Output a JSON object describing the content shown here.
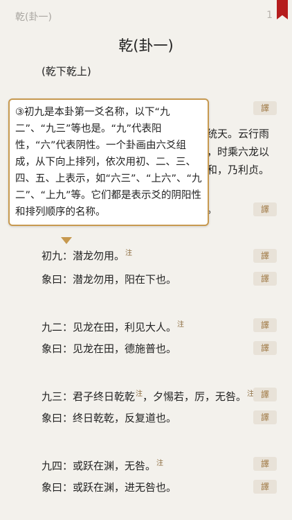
{
  "header": {
    "chapter": "乾(卦一)",
    "page": "1"
  },
  "title": "乾(卦一)",
  "subtitle": "(乾下乾上)",
  "yi_label": "譯",
  "zhu_mark": "注",
  "partial_text": {
    "t1": "乃统天。云行雨",
    "t2": "成，时乘六龙以",
    "t3": "大和，乃利贞。",
    "t4": "息。"
  },
  "lines": [
    {
      "text": "初九：潜龙勿用。",
      "sup": "注"
    },
    {
      "text": "象曰：潜龙勿用，阳在下也。",
      "sup": ""
    },
    {
      "text": "九二：见龙在田，利见大人。",
      "sup": "注"
    },
    {
      "text": "象曰：见龙在田，德施普也。",
      "sup": ""
    },
    {
      "text": "九三：君子终日乾乾",
      "sup": "注",
      "text2": "，夕惕若，厉，无咎。",
      "sup2": "注"
    },
    {
      "text": "象曰：终日乾乾，反复道也。",
      "sup": ""
    },
    {
      "text": "九四：或跃在渊，无咎。",
      "sup": "注"
    },
    {
      "text": "象曰：或跃在渊，进无咎也。",
      "sup": ""
    }
  ],
  "popup": {
    "text": "③初九是本卦第一爻名称，以下“九二”、“九三”等也是。“九”代表阳性，“六”代表阴性。一个卦画由六爻组成，从下向上排列，依次用初、二、三、四、五、上表示，如“六三”、“上六”、“九二”、“上九”等。它们都是表示爻的阴阳性和排列顺序的名称。"
  }
}
